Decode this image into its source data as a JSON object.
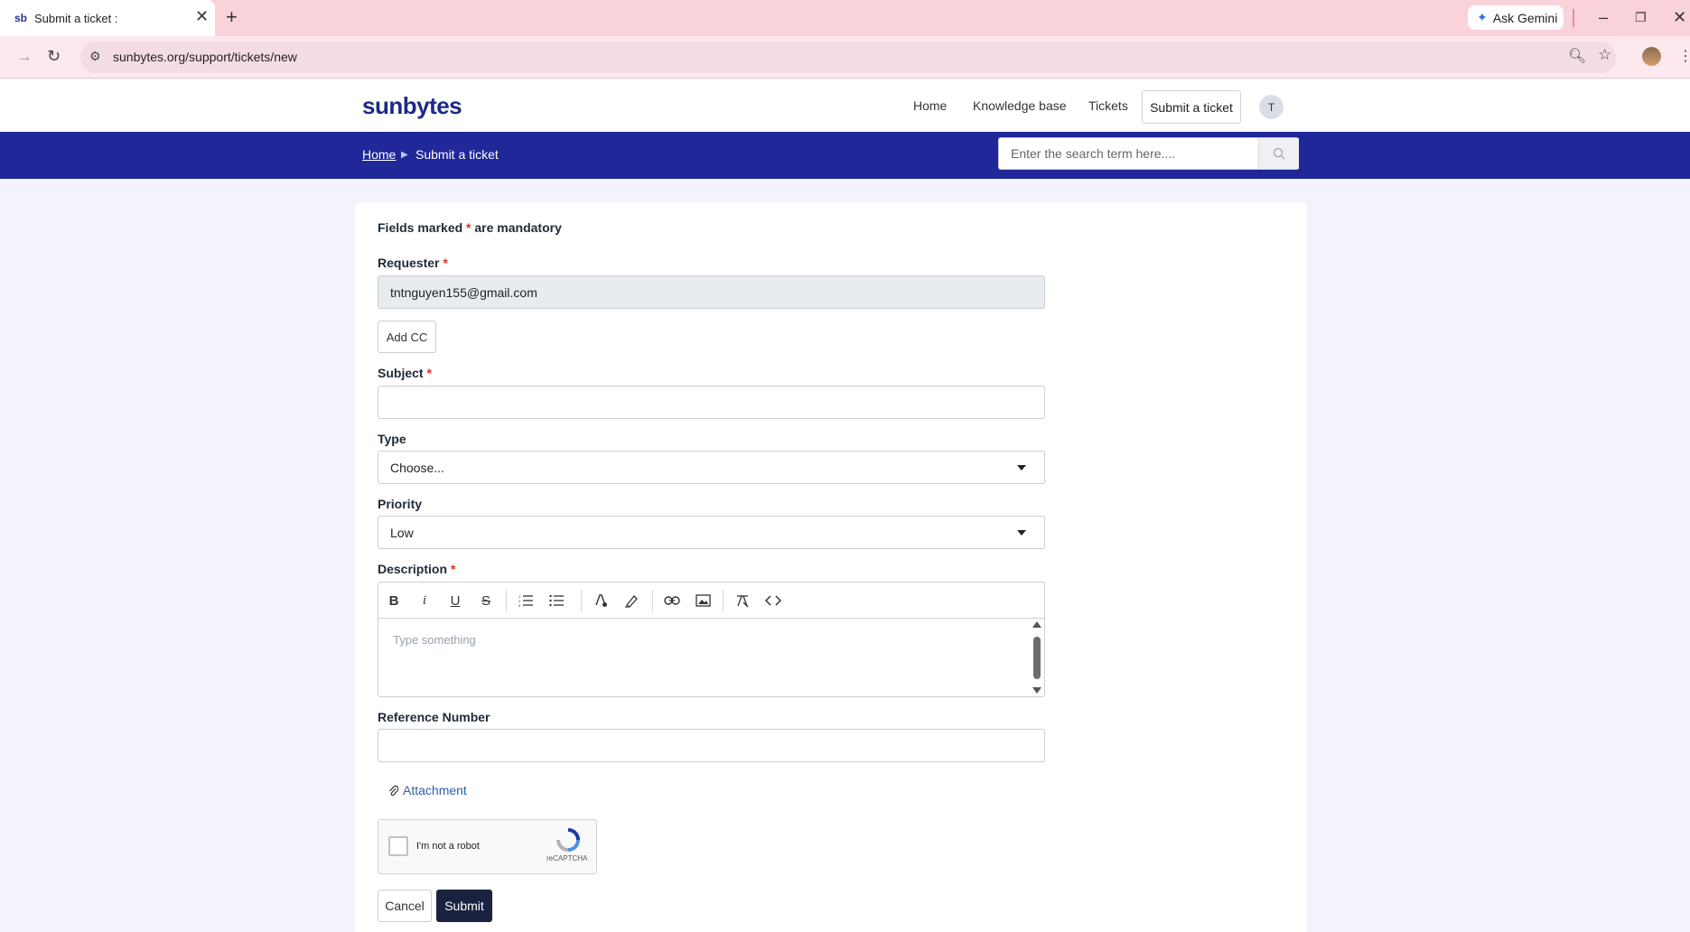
{
  "browser": {
    "tab_favicon": "sb",
    "tab_title": "Submit a ticket :",
    "tab_close": "✕",
    "new_tab": "+",
    "gemini_label": "Ask Gemini",
    "url": "sunbytes.org/support/tickets/new",
    "window_controls": [
      "–",
      "❐",
      "✕"
    ]
  },
  "header": {
    "logo": "sunbytes",
    "nav": [
      "Home",
      "Knowledge base",
      "Tickets",
      "Submit a ticket"
    ],
    "avatar_initial": "T"
  },
  "band": {
    "breadcrumb_home": "Home",
    "breadcrumb_current": "Submit a ticket",
    "search_placeholder": "Enter the search term here...."
  },
  "form": {
    "mandatory_prefix": "Fields marked",
    "mandatory_star": "*",
    "mandatory_suffix": "are mandatory",
    "requester_label": "Requester",
    "requester_value": "tntnguyen155@gmail.com",
    "add_cc": "Add CC",
    "subject_label": "Subject",
    "subject_value": "",
    "type_label": "Type",
    "type_value": "Choose...",
    "priority_label": "Priority",
    "priority_value": "Low",
    "description_label": "Description",
    "description_placeholder": "Type something",
    "reference_label": "Reference Number",
    "reference_value": "",
    "attachment": "Attachment",
    "captcha_label": "I'm not a robot",
    "captcha_brand": "reCAPTCHA",
    "cancel": "Cancel",
    "submit": "Submit",
    "required_mark": "*"
  },
  "toolbar_icons": [
    "bold-icon",
    "italic-icon",
    "underline-icon",
    "strikethrough-icon",
    "ordered-list-icon",
    "bullet-list-icon",
    "text-color-icon",
    "highlight-icon",
    "link-icon",
    "image-icon",
    "clear-format-icon",
    "code-icon"
  ],
  "colors": {
    "brand": "#1d2a86",
    "band": "#1f2799",
    "required": "#d9342b",
    "submit": "#1b2240",
    "link": "#2f5fa7"
  }
}
